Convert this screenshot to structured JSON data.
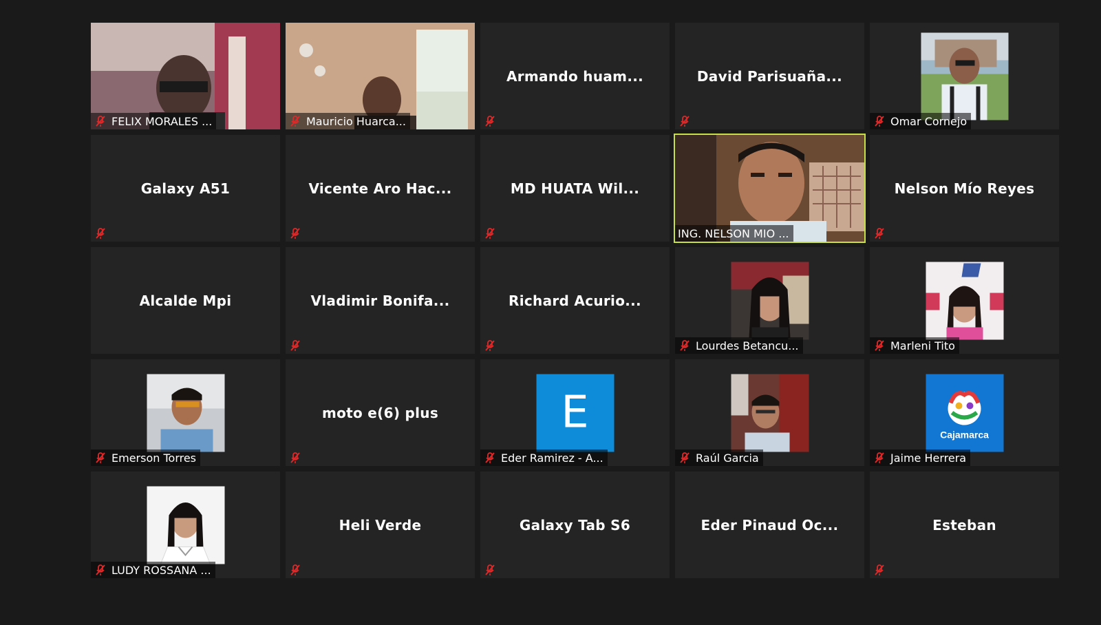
{
  "participants": [
    {
      "tile_label": "",
      "name_bar": "FELIX MORALES ...",
      "media": "video"
    },
    {
      "tile_label": "",
      "name_bar": "Mauricio Huarca...",
      "media": "video"
    },
    {
      "tile_label": "Armando  huam...",
      "name_bar": "",
      "media": "none"
    },
    {
      "tile_label": "David  Parisuaña...",
      "name_bar": "",
      "media": "none"
    },
    {
      "tile_label": "",
      "name_bar": "Omar Cornejo",
      "media": "photo"
    },
    {
      "tile_label": "Galaxy A51",
      "name_bar": "",
      "media": "none"
    },
    {
      "tile_label": "Vicente  Aro  Hac...",
      "name_bar": "",
      "media": "none"
    },
    {
      "tile_label": "MD  HUATA  Wil...",
      "name_bar": "",
      "media": "none"
    },
    {
      "tile_label": "",
      "name_bar": "ING. NELSON MIO ...",
      "media": "video",
      "active_speaker": true
    },
    {
      "tile_label": "Nelson  Mío  Reyes",
      "name_bar": "",
      "media": "none"
    },
    {
      "tile_label": "Alcalde Mpi",
      "name_bar": "",
      "media": "none"
    },
    {
      "tile_label": "Vladimir  Bonifa...",
      "name_bar": "",
      "media": "none"
    },
    {
      "tile_label": "Richard  Acurio...",
      "name_bar": "",
      "media": "none"
    },
    {
      "tile_label": "",
      "name_bar": "Lourdes Betancu...",
      "media": "photo"
    },
    {
      "tile_label": "",
      "name_bar": "Marleni Tito",
      "media": "photo"
    },
    {
      "tile_label": "",
      "name_bar": "Emerson Torres",
      "media": "photo"
    },
    {
      "tile_label": "moto e(6) plus",
      "name_bar": "",
      "media": "none"
    },
    {
      "tile_label": "",
      "name_bar": "Eder Ramirez - A...",
      "media": "letter",
      "avatar_letter": "E"
    },
    {
      "tile_label": "",
      "name_bar": "Raúl Garcia",
      "media": "photo"
    },
    {
      "tile_label": "",
      "name_bar": "Jaime Herrera",
      "media": "logo",
      "logo_text": "Cajamarca"
    },
    {
      "tile_label": "",
      "name_bar": "LUDY ROSSANA ...",
      "media": "photo"
    },
    {
      "tile_label": "Heli Verde",
      "name_bar": "",
      "media": "none"
    },
    {
      "tile_label": "Galaxy Tab S6",
      "name_bar": "",
      "media": "none"
    },
    {
      "tile_label": "Eder  Pinaud  Oc...",
      "name_bar": "",
      "media": "none"
    },
    {
      "tile_label": "Esteban",
      "name_bar": "",
      "media": "none"
    }
  ],
  "colors": {
    "background": "#1a1a1a",
    "tile": "#242424",
    "active_speaker_border": "#c6df4a",
    "muted_icon": "#e02828",
    "letter_avatar": "#0e8bd9"
  },
  "icons": {
    "muted": "muted-mic-icon"
  }
}
